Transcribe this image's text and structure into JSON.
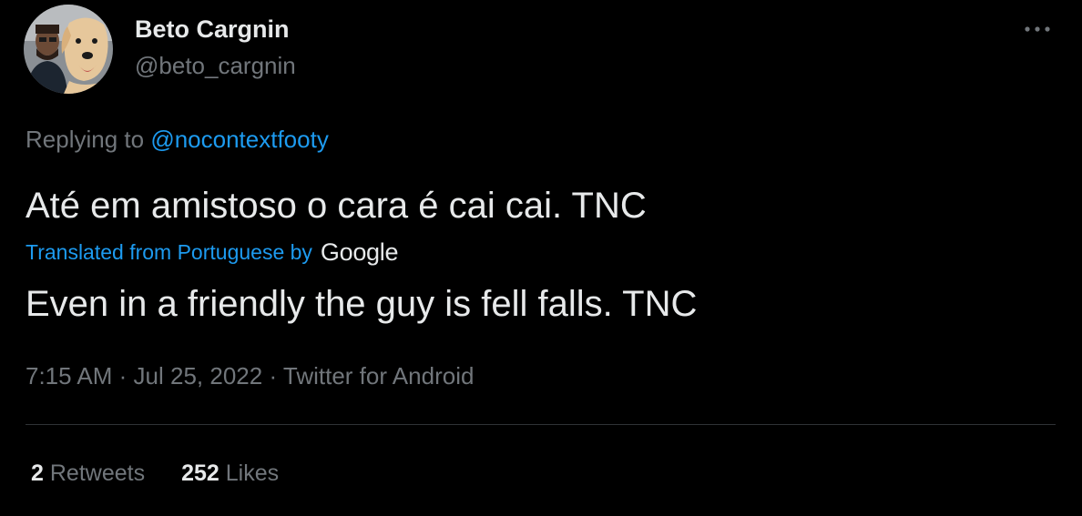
{
  "tweet": {
    "author": {
      "display_name": "Beto Cargnin",
      "handle": "@beto_cargnin"
    },
    "more_icon": "ellipsis-icon",
    "replying_prefix": "Replying to",
    "replying_to": "@nocontextfooty",
    "text": "Até em amistoso o cara é cai cai. TNC",
    "translation": {
      "label": "Translated from Portuguese by",
      "provider": "Google",
      "text": "Even in a friendly the guy is fell falls. TNC"
    },
    "meta": {
      "time": "7:15 AM",
      "separator": "·",
      "date": "Jul 25, 2022",
      "source": "Twitter for Android"
    },
    "stats": {
      "retweets_count": "2",
      "retweets_label": "Retweets",
      "likes_count": "252",
      "likes_label": "Likes"
    },
    "colors": {
      "background": "#000000",
      "primary_text": "#e7e9ea",
      "secondary_text": "#71767b",
      "accent": "#1d9bf0",
      "divider": "#2f3336"
    }
  }
}
